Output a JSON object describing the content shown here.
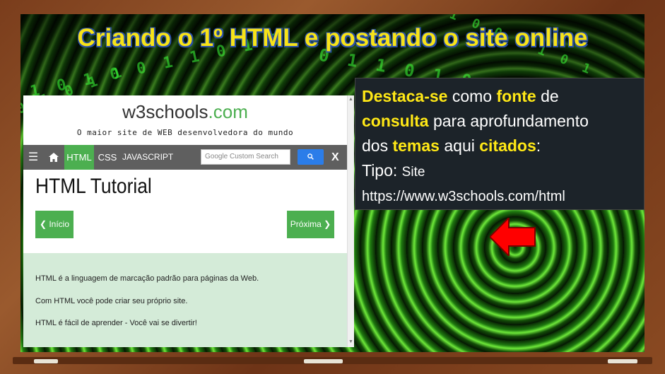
{
  "slide": {
    "title": "Criando o 1º HTML e postando o site online",
    "accent_title_color": "#f7e318",
    "background_icon": "matrix-binary-tunnel"
  },
  "browser": {
    "logo_text": "w3schools",
    "logo_suffix": ".com",
    "tagline": "O maior site de WEB desenvolvedora do mundo",
    "nav": {
      "menu_icon": "☰",
      "home_icon": "home-icon",
      "items": [
        "HTML",
        "CSS",
        "JAVASCRIPT"
      ],
      "active": "HTML",
      "search_placeholder": "Google Custom Search",
      "search_button_icon": "search-icon",
      "close_label": "X"
    },
    "page_heading": "HTML Tutorial",
    "prev_button": "❮ Início",
    "next_button": "Próxima ❯",
    "paragraphs": [
      "HTML é a linguagem de marcação padrão para páginas da Web.",
      "Com HTML você pode criar seu próprio site.",
      "HTML é fácil de aprender - Você vai se divertir!"
    ],
    "brand_color": "#4caf50"
  },
  "callout": {
    "w1": "Destaca-se",
    "w2": " como ",
    "w3": "fonte",
    "w4": " de",
    "w5": "consulta",
    "w6": " para aprofundamento",
    "w7": "dos ",
    "w8": "temas",
    "w9": " aqui ",
    "w10": "citados",
    "w11": ":",
    "type_label": "Tipo: ",
    "type_value": "Site",
    "url": "https://www.w3schools.com/html",
    "highlight_color": "#ffe816"
  },
  "pointer": {
    "icon": "red-arrow-left-icon",
    "color": "#ff0000"
  }
}
